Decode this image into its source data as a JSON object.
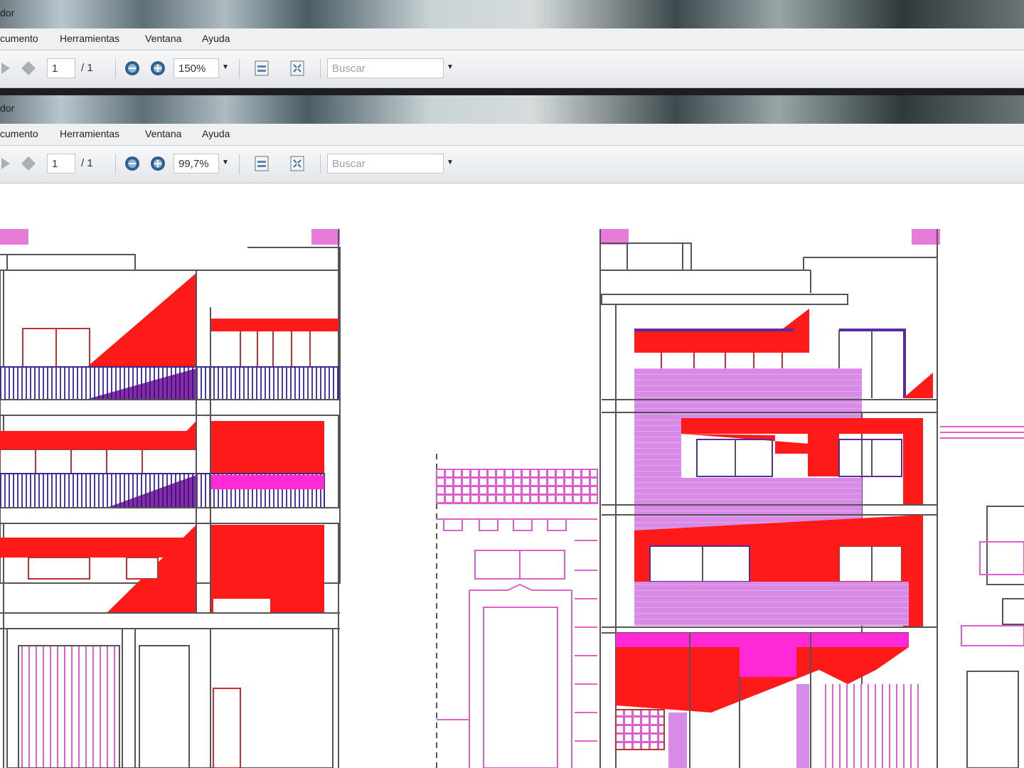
{
  "windows": [
    {
      "title": "dor",
      "menu": [
        "cumento",
        "Herramientas",
        "Ventana",
        "Ayuda"
      ],
      "toolbar": {
        "page_current": "1",
        "page_total": "/ 1",
        "zoom": "150%",
        "search_placeholder": "Buscar"
      }
    },
    {
      "title": "dor",
      "menu": [
        "cumento",
        "Herramientas",
        "Ventana",
        "Ayuda"
      ],
      "toolbar": {
        "page_current": "1",
        "page_total": "/ 1",
        "zoom": "99,7%",
        "search_placeholder": "Buscar"
      }
    }
  ],
  "icons": [
    "nav-forward-icon",
    "nav-back-icon",
    "zoom-out-icon",
    "zoom-in-icon",
    "fit-width-icon",
    "fit-page-icon",
    "dropdown-caret-icon"
  ],
  "colors": {
    "red": "#ff1a1a",
    "magenta": "#ff2ad6",
    "purple": "#5a2aa0",
    "violet_hatch": "#d98ae8",
    "line": "#444444",
    "pink_line": "#e05fd0",
    "toolbar_bg": "#e8eaed"
  }
}
